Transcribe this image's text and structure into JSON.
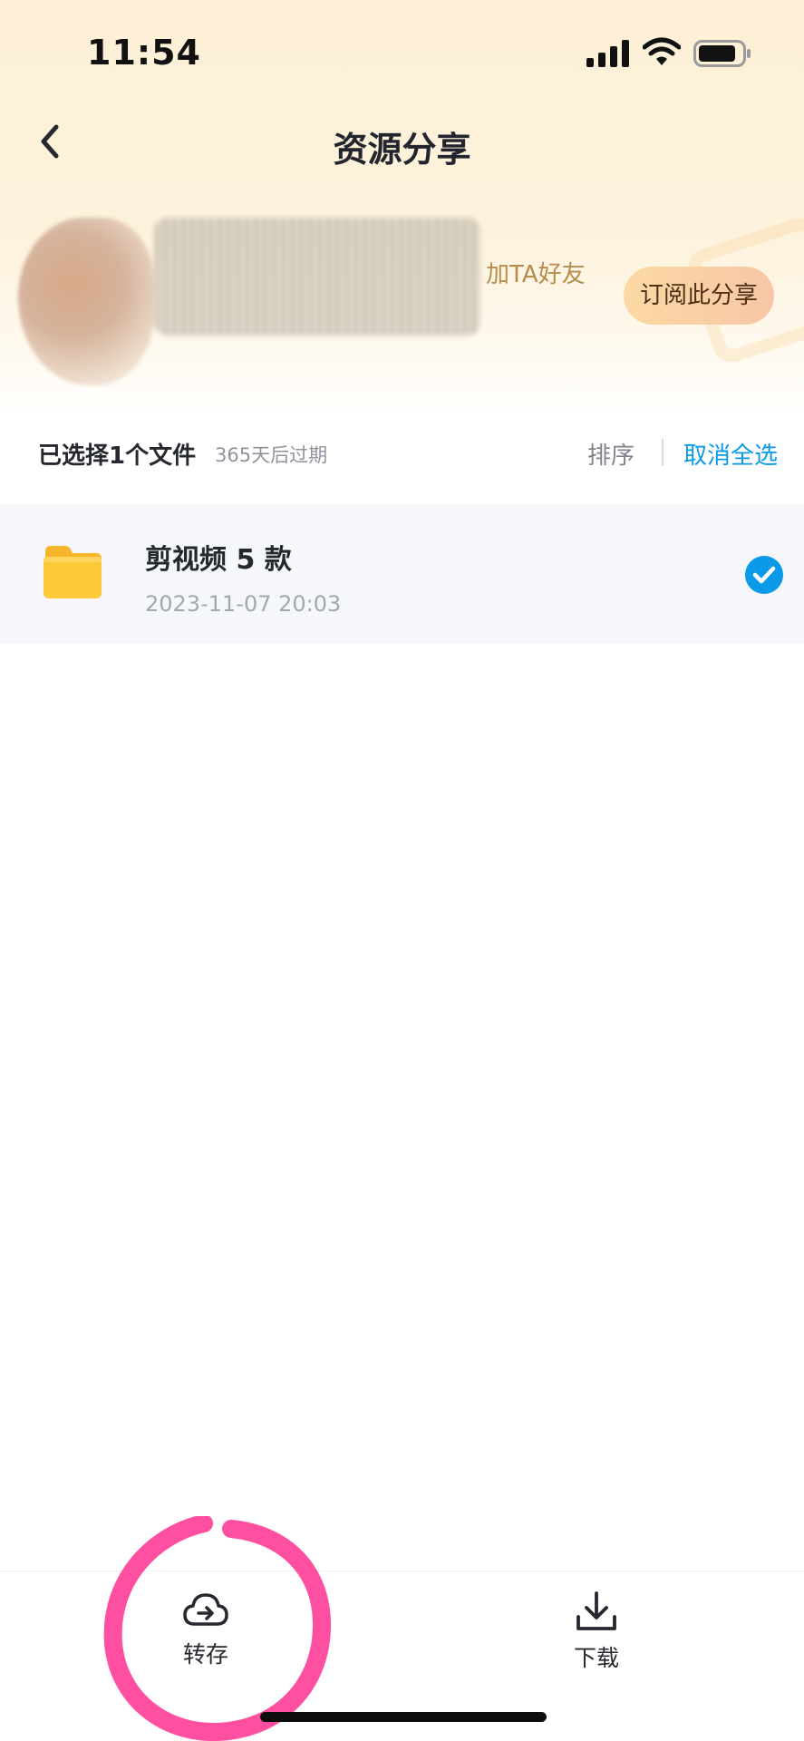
{
  "status_bar": {
    "time": "11:54"
  },
  "nav": {
    "title": "资源分享"
  },
  "profile": {
    "name_redacted": "",
    "add_friend_label": "加TA好友",
    "subscribe_label": "订阅此分享"
  },
  "selection_bar": {
    "selected_count": "已选择1个文件",
    "expiry": "365天后过期",
    "sort_label": "排序",
    "deselect_all_label": "取消全选"
  },
  "files": [
    {
      "name": "剪视频 5 款",
      "date": "2023-11-07 20:03",
      "selected": true,
      "icon": "folder-icon"
    }
  ],
  "toolbar": {
    "save_label": "转存",
    "save_icon": "cloud-transfer-icon",
    "download_label": "下载",
    "download_icon": "download-icon"
  },
  "colors": {
    "accent": "#0a9ae8",
    "folder": "#fbc73a",
    "header_bg": "#fdf0d6",
    "highlight": "#ff4fa0"
  }
}
